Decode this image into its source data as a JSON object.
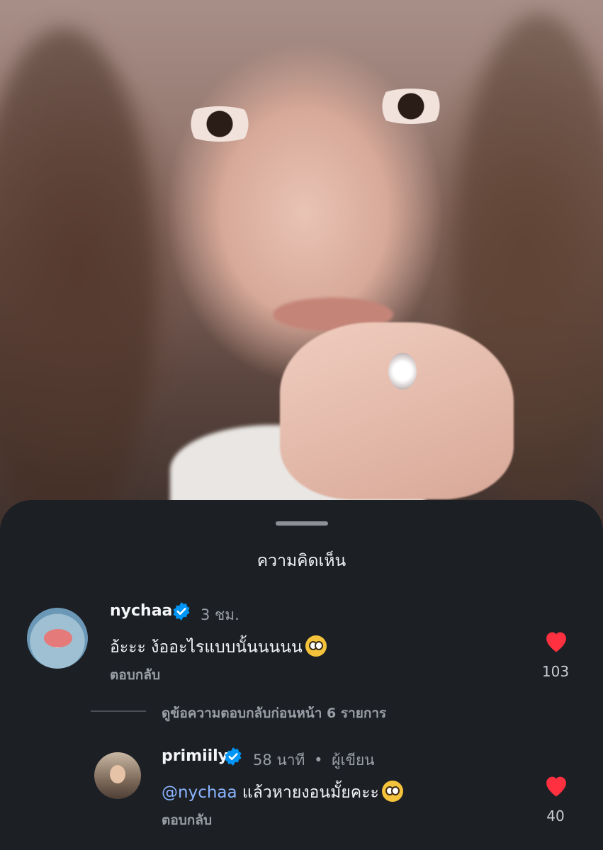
{
  "sheet": {
    "title": "ความคิดเห็น"
  },
  "comments": [
    {
      "username": "nychaa",
      "verified": true,
      "time": "3 ชม.",
      "text": "อ้ะะะ ง้ออะไรแบบนั้นนนนน",
      "emoji": "pleading-face",
      "reply_label": "ตอบกลับ",
      "likes": "103"
    }
  ],
  "view_previous_replies": "ดูข้อความตอบกลับก่อนหน้า 6 รายการ",
  "replies": [
    {
      "username": "primiily",
      "verified": true,
      "time": "58 นาที",
      "separator": "•",
      "author_label": "ผู้เขียน",
      "mention": "@nychaa",
      "text": " แล้วหายงอนมั้ยคะะ",
      "emoji": "pleading-face",
      "reply_label": "ตอบกลับ",
      "likes": "40"
    }
  ],
  "colors": {
    "sheet_bg": "#1c1f24",
    "heart": "#ff3040",
    "verified": "#0095f6",
    "mention": "#8ab4ff"
  }
}
